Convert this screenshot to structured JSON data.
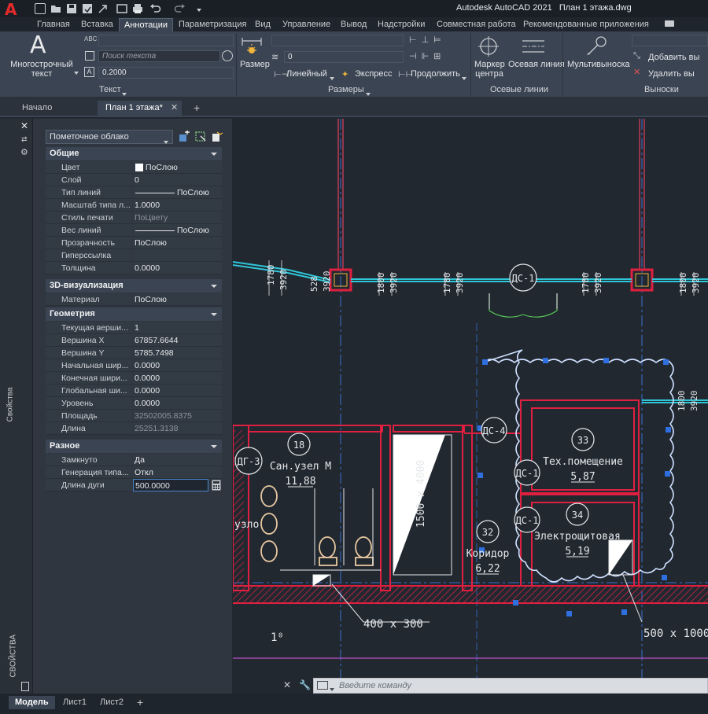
{
  "title_bar": {
    "app_title": "Autodesk AutoCAD 2021",
    "file_title": "План 1 этажа.dwg"
  },
  "ribbon_tabs": [
    "Главная",
    "Вставка",
    "Аннотации",
    "Параметризация",
    "Вид",
    "Управление",
    "Вывод",
    "Надстройки",
    "Совместная работа",
    "Рекомендованные приложения"
  ],
  "ribbon_active_tab": "Аннотации",
  "ribbon": {
    "text_panel": {
      "mtext_label_1": "Многострочный",
      "mtext_label_2": "текст",
      "search_placeholder": "Поиск текста",
      "height_value": "0.2000",
      "title": "Текст"
    },
    "dim_panel": {
      "size_label": "Размер",
      "linear_label": "Линейный",
      "express_label": "Экспресс",
      "continue_label": "Продолжить",
      "style_value": "0",
      "title": "Размеры"
    },
    "centerline_panel": {
      "marker_label_1": "Маркер",
      "marker_label_2": "центра",
      "centerline_label": "Осевая линия",
      "title": "Осевые линии"
    },
    "leader_panel": {
      "multileader_label": "Мультивыноска",
      "add_label": "Добавить вы",
      "remove_label": "Удалить вы",
      "title": "Выноски"
    }
  },
  "doc_tabs": [
    "Начало",
    "План 1 этажа*"
  ],
  "doc_tab_add": "+",
  "properties": {
    "object_type": "Пометочное облако",
    "side_title": "Свойства",
    "side_title_bottom": "СВОЙСТВА",
    "sections": {
      "general": "Общие",
      "viz3d": "3D-визуализация",
      "geometry": "Геометрия",
      "misc": "Разное"
    },
    "general_rows": [
      {
        "label": "Цвет",
        "value": "ПоСлою"
      },
      {
        "label": "Слой",
        "value": "0"
      },
      {
        "label": "Тип линий",
        "value": "ПоСлою"
      },
      {
        "label": "Масштаб типа л...",
        "value": "1.0000"
      },
      {
        "label": "Стиль печати",
        "value": "ПоЦвету"
      },
      {
        "label": "Вес линий",
        "value": "ПоСлою"
      },
      {
        "label": "Прозрачность",
        "value": "ПоСлою"
      },
      {
        "label": "Гиперссылка",
        "value": ""
      },
      {
        "label": "Толщина",
        "value": "0.0000"
      }
    ],
    "viz3d_rows": [
      {
        "label": "Материал",
        "value": "ПоСлою"
      }
    ],
    "geometry_rows": [
      {
        "label": "Текущая верши...",
        "value": "1"
      },
      {
        "label": "Вершина X",
        "value": "67857.6644"
      },
      {
        "label": "Вершина Y",
        "value": "5785.7498"
      },
      {
        "label": "Начальная шир...",
        "value": "0.0000"
      },
      {
        "label": "Конечная шири...",
        "value": "0.0000"
      },
      {
        "label": "Глобальная ши...",
        "value": "0.0000"
      },
      {
        "label": "Уровень",
        "value": "0.0000"
      },
      {
        "label": "Площадь",
        "value": "32502005.8375"
      },
      {
        "label": "Длина",
        "value": "25251.3138"
      }
    ],
    "misc_rows": [
      {
        "label": "Замкнуто",
        "value": "Да"
      },
      {
        "label": "Генерация типа...",
        "value": "Откл"
      },
      {
        "label": "Длина дуги",
        "value": "500.0000"
      }
    ]
  },
  "drawing": {
    "dims": [
      "1780",
      "3920",
      "528",
      "3920",
      "1800",
      "3920",
      "1780",
      "3920",
      "1780",
      "3920",
      "1800",
      "3920",
      "1800",
      "3920"
    ],
    "doors": {
      "ds1": "ДС-1",
      "ds4": "ДС-4",
      "ds1b": "ДС-1",
      "ds1c": "ДС-1",
      "dg3": "ДГ-3"
    },
    "rooms": [
      {
        "num": "18",
        "name": "Сан.узел М",
        "area": "11,88"
      },
      {
        "num": "33",
        "name": "Тех.помещение",
        "area": "5,87"
      },
      {
        "num": "34",
        "name": "Электрощитовая",
        "area": "5,19"
      },
      {
        "num": "32",
        "name": "Коридор",
        "area": "6,22"
      }
    ],
    "room_fragment": "узло",
    "shaft_label": "1500 x 4000",
    "opening_1": "400 x 300",
    "opening_2": "500 x 1000",
    "stair_mark": "1⁰"
  },
  "command_line": {
    "placeholder": "Введите команду"
  },
  "layout_tabs": [
    "Модель",
    "Лист1",
    "Лист2"
  ],
  "layout_tab_add": "+"
}
